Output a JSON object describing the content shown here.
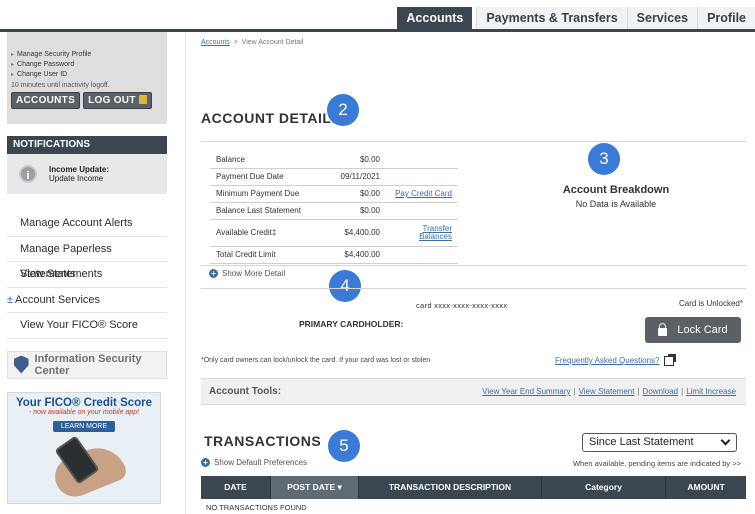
{
  "nav": {
    "tabs": [
      "Accounts",
      "Payments & Transfers",
      "Services",
      "Profile"
    ],
    "active": "Accounts"
  },
  "sidebar": {
    "profile_links": [
      "Manage Security Profile",
      "Change Password",
      "Change User ID"
    ],
    "timeout": "10 minutes until inactivity logoff.",
    "accounts_btn": "ACCOUNTS",
    "logout_btn": "LOG OUT",
    "notifications_title": "NOTIFICATIONS",
    "notification_title": "Income Update:",
    "notification_text": "Update Income",
    "links": [
      "Manage Account Alerts",
      "Manage Paperless Statements",
      "View Statements",
      "Account Services",
      "View Your FICO® Score"
    ],
    "account_services_prefix": "±",
    "info_center": "Information Security Center",
    "ad": {
      "title": "Your FICO® Credit Score",
      "subtitle": "- now available on your mobile app!",
      "button": "LEARN MORE"
    }
  },
  "breadcrumb": {
    "link": "Accounts",
    "separator": ">",
    "current": "View Account Detail"
  },
  "markers": [
    "2",
    "3",
    "4",
    "5"
  ],
  "account_detail": {
    "title": "ACCOUNT DETAIL:",
    "rows": [
      {
        "label": "Balance",
        "value": "$0.00",
        "action": ""
      },
      {
        "label": "Payment Due Date",
        "value": "09/11/2021",
        "action": ""
      },
      {
        "label": "Minimum Payment Due",
        "value": "$0.00",
        "action": "Pay Credit Card"
      },
      {
        "label": "Balance Last Statement",
        "value": "$0.00",
        "action": ""
      },
      {
        "label": "Available Credit‡",
        "value": "$4,400.00",
        "action": "Transfer Balances"
      },
      {
        "label": "Total Credit Limit",
        "value": "$4,400.00",
        "action": ""
      }
    ],
    "show_more": "Show More Detail",
    "breakdown_title": "Account Breakdown",
    "breakdown_empty": "No Data is Available"
  },
  "card": {
    "number": "card xxxx-xxxx-xxxx-xxxx",
    "status": "Card is Unlocked*",
    "holder_label": "PRIMARY CARDHOLDER:",
    "lock_button": "Lock Card",
    "note": "*Only card owners can lock/unlock the card. If your card was lost or stolen",
    "faq": "Frequently Asked Questions?"
  },
  "tools": {
    "label": "Account Tools:",
    "links": [
      "View Year End Summary",
      "View Statement",
      "Download",
      "Limit Increase"
    ]
  },
  "transactions": {
    "title": "TRANSACTIONS",
    "prefs": "Show Default Preferences",
    "filter": "Since Last Statement",
    "pending_note": "When available, pending items are indicated by >>",
    "columns": [
      "DATE",
      "POST DATE",
      "TRANSACTION DESCRIPTION",
      "Category",
      "AMOUNT"
    ],
    "sort_indicator": "▾",
    "empty": "NO TRANSACTIONS FOUND"
  },
  "colors": {
    "nav_dark": "#3b4651",
    "link": "#3a6ea5",
    "marker": "#3b7bd6"
  }
}
